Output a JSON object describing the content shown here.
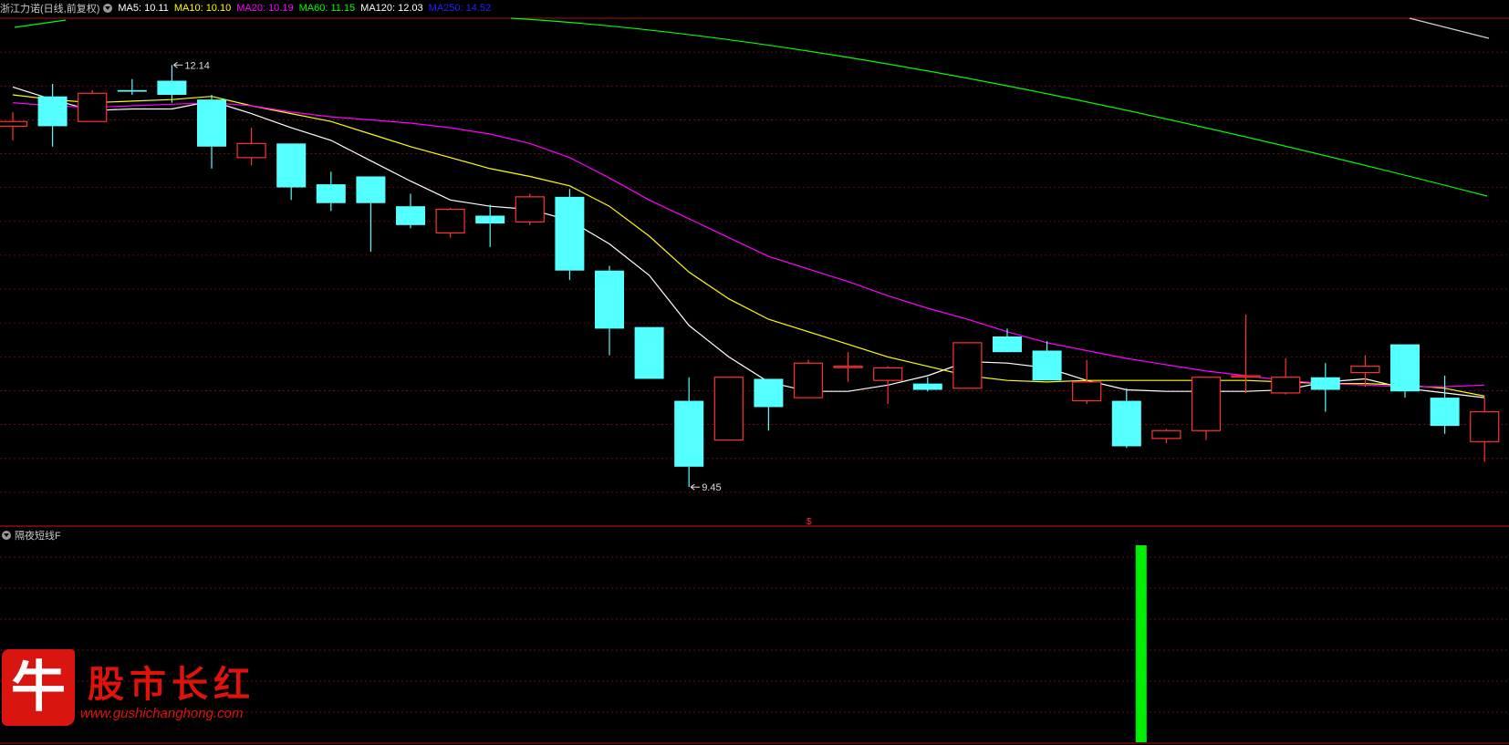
{
  "header": {
    "stock_name": "浙江力诺",
    "period": "(日线,前复权)",
    "ma_labels": [
      {
        "label": "MA5: 10.11",
        "color": "#ffffff"
      },
      {
        "label": "MA10: 10.10",
        "color": "#ffff00"
      },
      {
        "label": "MA20: 10.19",
        "color": "#ff00ff"
      },
      {
        "label": "MA60: 11.15",
        "color": "#00ff00"
      },
      {
        "label": "MA120: 12.03",
        "color": "#ffffff"
      },
      {
        "label": "MA250: 14.52",
        "color": "#2020ff"
      }
    ]
  },
  "sub_indicator": {
    "name": "隔夜短线F"
  },
  "watermark": {
    "logo_char": "牛",
    "text": "股市长红",
    "url": "www.gushichanghong.com"
  },
  "chart_data": {
    "type": "candlestick",
    "price_range": [
      9.3,
      12.38
    ],
    "up_color": "#ff3232",
    "down_color": "#54ffff",
    "bars": [
      {
        "o": 11.75,
        "h": 11.84,
        "l": 11.66,
        "c": 11.78
      },
      {
        "o": 11.94,
        "h": 12.02,
        "l": 11.62,
        "c": 11.75
      },
      {
        "o": 11.78,
        "h": 11.98,
        "l": 11.78,
        "c": 11.96
      },
      {
        "o": 11.98,
        "h": 12.05,
        "l": 11.95,
        "c": 11.97
      },
      {
        "o": 12.04,
        "h": 12.14,
        "l": 11.9,
        "c": 11.95
      },
      {
        "o": 11.92,
        "h": 11.95,
        "l": 11.48,
        "c": 11.62
      },
      {
        "o": 11.55,
        "h": 11.74,
        "l": 11.5,
        "c": 11.64
      },
      {
        "o": 11.64,
        "h": 11.64,
        "l": 11.28,
        "c": 11.36
      },
      {
        "o": 11.38,
        "h": 11.46,
        "l": 11.21,
        "c": 11.26
      },
      {
        "o": 11.43,
        "h": 11.43,
        "l": 10.95,
        "c": 11.26
      },
      {
        "o": 11.24,
        "h": 11.32,
        "l": 11.1,
        "c": 11.12
      },
      {
        "o": 11.07,
        "h": 11.23,
        "l": 11.04,
        "c": 11.22
      },
      {
        "o": 11.18,
        "h": 11.25,
        "l": 10.98,
        "c": 11.13
      },
      {
        "o": 11.14,
        "h": 11.32,
        "l": 11.12,
        "c": 11.3
      },
      {
        "o": 11.3,
        "h": 11.35,
        "l": 10.77,
        "c": 10.83
      },
      {
        "o": 10.83,
        "h": 10.86,
        "l": 10.29,
        "c": 10.46
      },
      {
        "o": 10.47,
        "h": 10.47,
        "l": 10.14,
        "c": 10.14
      },
      {
        "o": 10.0,
        "h": 10.15,
        "l": 9.45,
        "c": 9.58
      },
      {
        "o": 9.75,
        "h": 10.15,
        "l": 9.75,
        "c": 10.15
      },
      {
        "o": 10.14,
        "h": 10.14,
        "l": 9.81,
        "c": 9.96
      },
      {
        "o": 10.02,
        "h": 10.26,
        "l": 10.02,
        "c": 10.24
      },
      {
        "o": 10.22,
        "h": 10.31,
        "l": 10.12,
        "c": 10.22
      },
      {
        "o": 10.13,
        "h": 10.22,
        "l": 9.98,
        "c": 10.21
      },
      {
        "o": 10.11,
        "h": 10.15,
        "l": 10.06,
        "c": 10.07
      },
      {
        "o": 10.08,
        "h": 10.37,
        "l": 10.08,
        "c": 10.37
      },
      {
        "o": 10.41,
        "h": 10.46,
        "l": 10.32,
        "c": 10.31
      },
      {
        "o": 10.32,
        "h": 10.38,
        "l": 10.13,
        "c": 10.13
      },
      {
        "o": 10.0,
        "h": 10.26,
        "l": 9.98,
        "c": 10.12
      },
      {
        "o": 10.0,
        "h": 10.08,
        "l": 9.7,
        "c": 9.71
      },
      {
        "o": 9.76,
        "h": 9.82,
        "l": 9.73,
        "c": 9.81
      },
      {
        "o": 9.81,
        "h": 10.15,
        "l": 9.75,
        "c": 10.15
      },
      {
        "o": 10.16,
        "h": 10.55,
        "l": 10.05,
        "c": 10.16
      },
      {
        "o": 10.05,
        "h": 10.27,
        "l": 10.04,
        "c": 10.15
      },
      {
        "o": 10.15,
        "h": 10.24,
        "l": 9.93,
        "c": 10.07
      },
      {
        "o": 10.18,
        "h": 10.29,
        "l": 10.09,
        "c": 10.22
      },
      {
        "o": 10.36,
        "h": 10.36,
        "l": 10.02,
        "c": 10.06
      },
      {
        "o": 10.02,
        "h": 10.16,
        "l": 9.79,
        "c": 9.84
      },
      {
        "o": 9.74,
        "h": 10.02,
        "l": 9.61,
        "c": 9.93
      }
    ],
    "ma_lines": [
      {
        "name": "MA5",
        "color": "#ffffff",
        "values": [
          12.0,
          11.92,
          11.85,
          11.86,
          11.86,
          11.91,
          11.83,
          11.74,
          11.66,
          11.53,
          11.4,
          11.28,
          11.24,
          11.22,
          11.15,
          11.0,
          10.8,
          10.48,
          10.28,
          10.12,
          10.06,
          10.06,
          10.1,
          10.16,
          10.25,
          10.24,
          10.21,
          10.13,
          10.07,
          10.06,
          10.06,
          10.06,
          10.07,
          10.12,
          10.14,
          10.08,
          10.05,
          10.02
        ]
      },
      {
        "name": "MA10",
        "color": "#ffff00",
        "values": [
          11.95,
          11.92,
          11.9,
          11.91,
          11.92,
          11.94,
          11.88,
          11.83,
          11.78,
          11.7,
          11.62,
          11.55,
          11.48,
          11.43,
          11.37,
          11.24,
          11.05,
          10.82,
          10.65,
          10.52,
          10.44,
          10.36,
          10.28,
          10.22,
          10.16,
          10.13,
          10.12,
          10.13,
          10.13,
          10.13,
          10.13,
          10.13,
          10.12,
          10.11,
          10.11,
          10.1,
          10.08,
          10.03
        ]
      },
      {
        "name": "MA20",
        "color": "#ff00ff",
        "values": [
          11.9,
          11.88,
          11.87,
          11.88,
          11.89,
          11.9,
          11.88,
          11.84,
          11.81,
          11.79,
          11.77,
          11.74,
          11.7,
          11.64,
          11.55,
          11.42,
          11.28,
          11.16,
          11.04,
          10.92,
          10.84,
          10.76,
          10.67,
          10.59,
          10.52,
          10.44,
          10.37,
          10.32,
          10.27,
          10.23,
          10.19,
          10.16,
          10.13,
          10.11,
          10.1,
          10.09,
          10.09,
          10.1
        ]
      }
    ],
    "ma60_line": {
      "name": "MA60",
      "color": "#00ff00"
    },
    "ma120_line": {
      "name": "MA120",
      "color": "#ffffff"
    },
    "annotations": [
      {
        "label": "12.14",
        "bar_index": 4,
        "price": 12.14
      },
      {
        "label": "9.45",
        "bar_index": 17,
        "price": 9.45
      }
    ],
    "signals": [
      {
        "bar_index": 28,
        "value": 1,
        "color": "#00ee00"
      }
    ]
  }
}
